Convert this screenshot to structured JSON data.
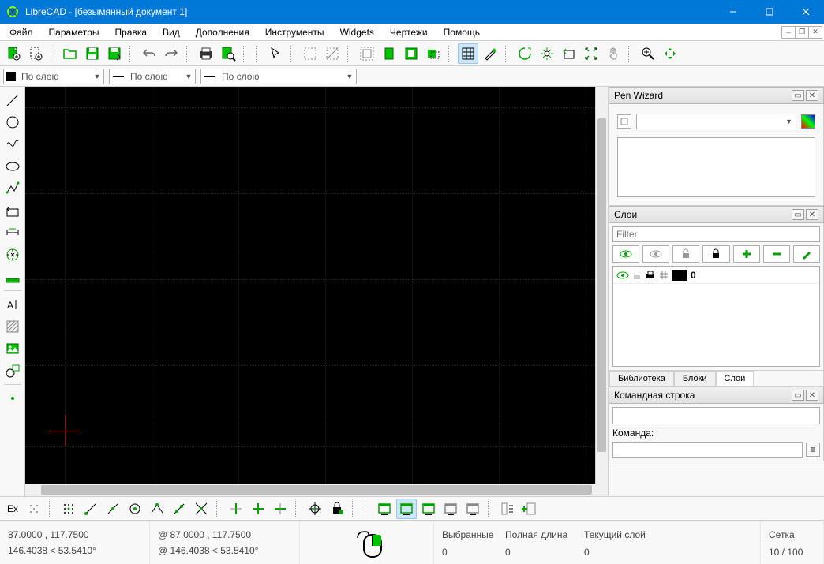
{
  "title": "LibreCAD - [безымянный документ 1]",
  "menu": [
    "Файл",
    "Параметры",
    "Правка",
    "Вид",
    "Дополнения",
    "Инструменты",
    "Widgets",
    "Чертежи",
    "Помощь"
  ],
  "combos": {
    "layer": "По слою",
    "ltype": "По слою",
    "lwidth": "По слою"
  },
  "penwizard": {
    "title": "Pen Wizard"
  },
  "layers": {
    "title": "Слои",
    "filter_ph": "Filter",
    "row_name": "0",
    "tabs": [
      "Библиотека",
      "Блоки",
      "Слои"
    ],
    "active_tab": 2
  },
  "cmd": {
    "title": "Командная строка",
    "label": "Команда:"
  },
  "btb_ex": "Ex",
  "status": {
    "coord_abs": "87.0000 , 117.7500",
    "coord_rel": "@  87.0000 , 117.7500",
    "polar_abs": "146.4038 < 53.5410°",
    "polar_rel": "@  146.4038 < 53.5410°",
    "headers": [
      "Выбранные",
      "Полная длина",
      "Текущий слой",
      "Сетка"
    ],
    "vals": [
      "0",
      "0",
      "0",
      "10 / 100"
    ]
  }
}
